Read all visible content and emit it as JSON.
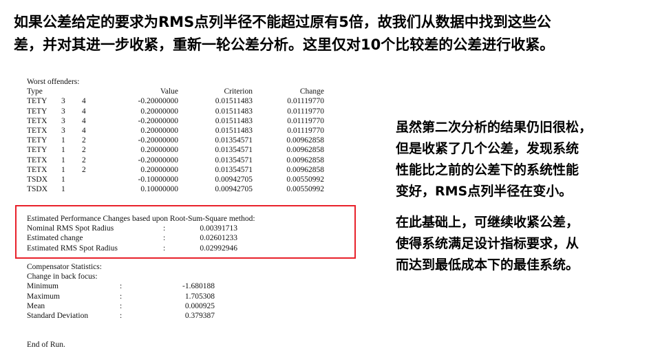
{
  "heading": {
    "line1": "如果公差给定的要求为RMS点列半径不能超过原有5倍，故我们从数据中找到这些公",
    "line2": "差，并对其进一步收紧，重新一轮公差分析。这里仅对10个比较差的公差进行收紧。"
  },
  "report": {
    "title": "Worst offenders:",
    "headers": {
      "type": "Type",
      "value": "Value",
      "criterion": "Criterion",
      "change": "Change"
    },
    "rows": [
      {
        "type": "TETY",
        "i": "3",
        "j": "4",
        "value": "-0.20000000",
        "criterion": "0.01511483",
        "change": "0.01119770"
      },
      {
        "type": "TETY",
        "i": "3",
        "j": "4",
        "value": "0.20000000",
        "criterion": "0.01511483",
        "change": "0.01119770"
      },
      {
        "type": "TETX",
        "i": "3",
        "j": "4",
        "value": "-0.20000000",
        "criterion": "0.01511483",
        "change": "0.01119770"
      },
      {
        "type": "TETX",
        "i": "3",
        "j": "4",
        "value": "0.20000000",
        "criterion": "0.01511483",
        "change": "0.01119770"
      },
      {
        "type": "TETY",
        "i": "1",
        "j": "2",
        "value": "-0.20000000",
        "criterion": "0.01354571",
        "change": "0.00962858"
      },
      {
        "type": "TETY",
        "i": "1",
        "j": "2",
        "value": "0.20000000",
        "criterion": "0.01354571",
        "change": "0.00962858"
      },
      {
        "type": "TETX",
        "i": "1",
        "j": "2",
        "value": "-0.20000000",
        "criterion": "0.01354571",
        "change": "0.00962858"
      },
      {
        "type": "TETX",
        "i": "1",
        "j": "2",
        "value": "0.20000000",
        "criterion": "0.01354571",
        "change": "0.00962858"
      },
      {
        "type": "TSDX",
        "i": "1",
        "j": "",
        "value": "-0.10000000",
        "criterion": "0.00942705",
        "change": "0.00550992"
      },
      {
        "type": "TSDX",
        "i": "1",
        "j": "",
        "value": "0.10000000",
        "criterion": "0.00942705",
        "change": "0.00550992"
      }
    ]
  },
  "estimate": {
    "title": "Estimated Performance Changes based upon Root-Sum-Square method:",
    "rows": [
      {
        "label": "Nominal RMS Spot Radius",
        "colon": ":",
        "value": "0.00391713"
      },
      {
        "label": "Estimated change",
        "colon": ":",
        "value": "0.02601233"
      },
      {
        "label": "Estimated RMS Spot Radius",
        "colon": ":",
        "value": "0.02992946"
      }
    ],
    "box_color": "#e8202a"
  },
  "compensator": {
    "title": "Compensator Statistics:",
    "subtitle": "Change in back focus:",
    "rows": [
      {
        "label": "Minimum",
        "colon": ":",
        "value": "-1.680188"
      },
      {
        "label": "Maximum",
        "colon": ":",
        "value": "1.705308"
      },
      {
        "label": "Mean",
        "colon": ":",
        "value": "0.000925"
      },
      {
        "label": "Standard Deviation",
        "colon": ":",
        "value": "0.379387"
      }
    ]
  },
  "end_text": "End of Run.",
  "side": {
    "para1": [
      "虽然第二次分析的结果仍旧很松，",
      "但是收紧了几个公差，发现系统",
      "性能比之前的公差下的系统性能",
      "变好，RMS点列半径在变小。"
    ],
    "para2": [
      "在此基础上，可继续收紧公差，",
      "使得系统满足设计指标要求，从",
      "而达到最低成本下的最佳系统。"
    ]
  }
}
